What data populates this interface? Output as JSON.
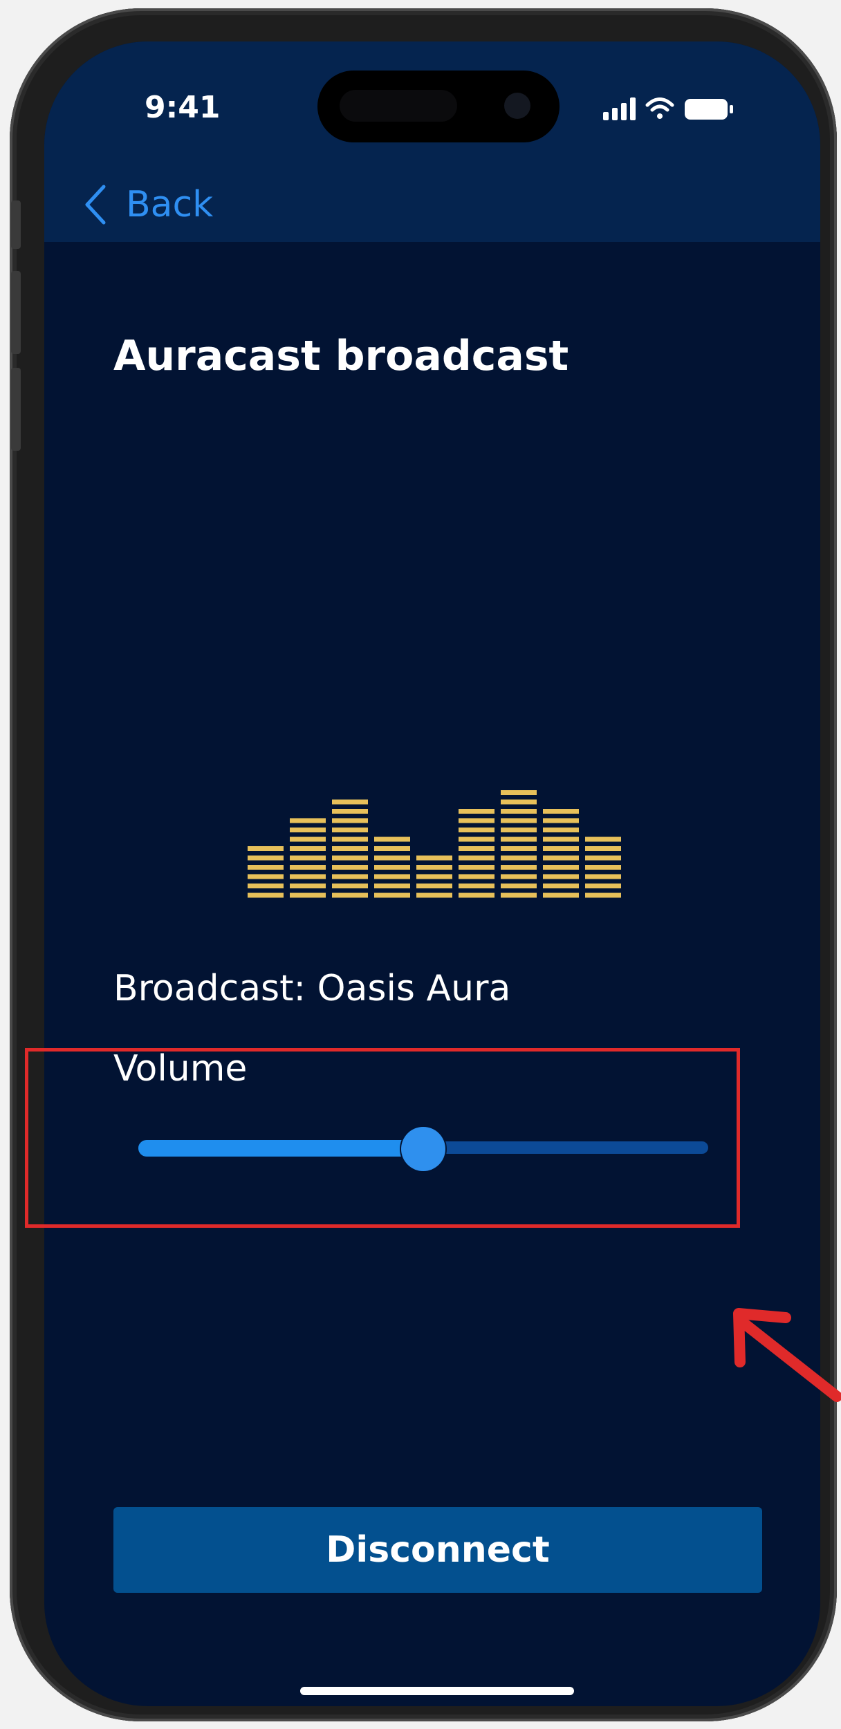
{
  "status_bar": {
    "time": "9:41"
  },
  "nav": {
    "back_label": "Back"
  },
  "page": {
    "title": "Auracast broadcast"
  },
  "equalizer": {
    "bar_segment_counts": [
      6,
      9,
      11,
      7,
      5,
      10,
      12,
      10,
      7
    ],
    "bar_color": "#e7c05a"
  },
  "broadcast": {
    "text": "Broadcast: Oasis Aura"
  },
  "volume": {
    "label": "Volume",
    "level_fraction": 0.5
  },
  "actions": {
    "disconnect_label": "Disconnect"
  },
  "colors": {
    "background": "#021333",
    "accent": "#2f8ff2",
    "button": "#03508f",
    "annotation": "#e02a2a"
  },
  "icons": [
    "back-chevron-icon",
    "cellular-signal-icon",
    "wifi-icon",
    "battery-icon",
    "annotation-arrow-icon"
  ]
}
